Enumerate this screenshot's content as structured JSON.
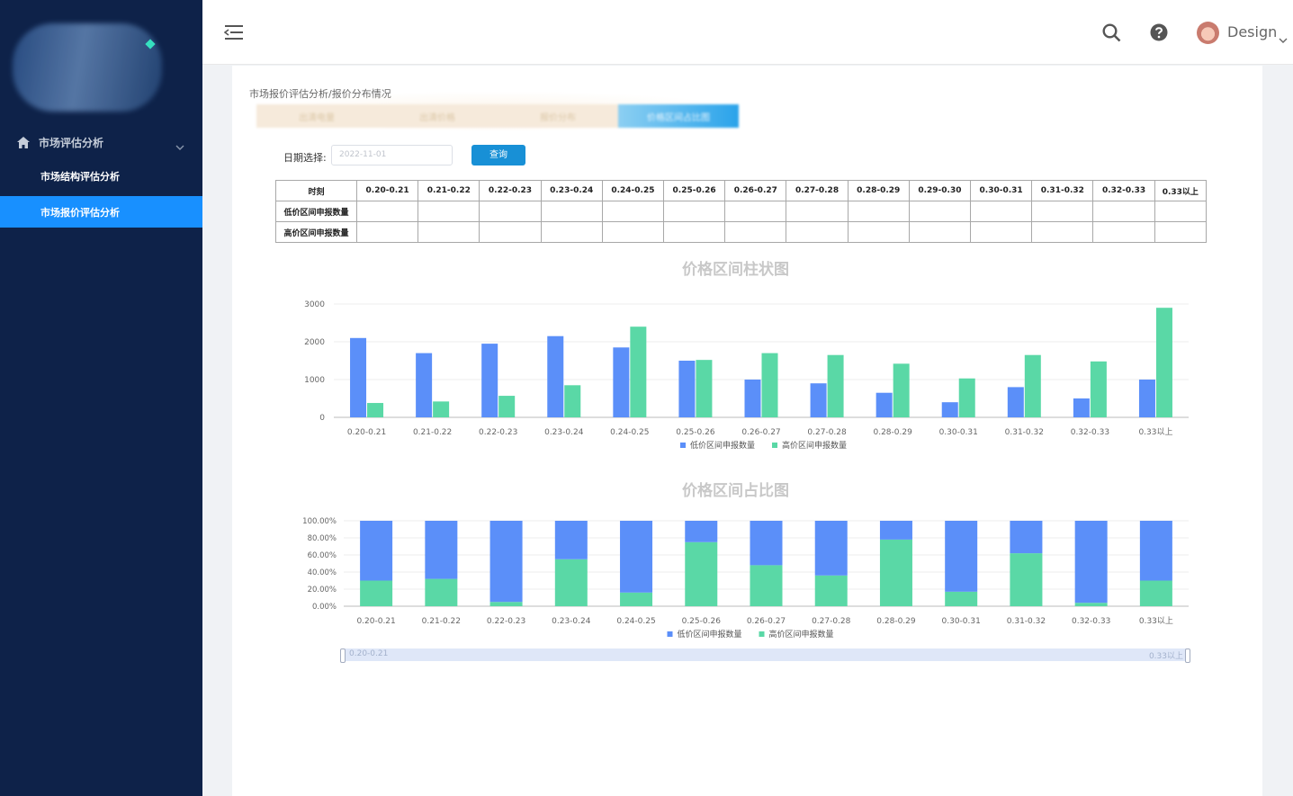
{
  "sidebar": {
    "group_label": "市场评估分析",
    "items": [
      {
        "label": "市场结构评估分析"
      },
      {
        "label": "市场报价评估分析"
      }
    ]
  },
  "header": {
    "user_name": "Design"
  },
  "breadcrumb": "市场报价评估分析/报价分布情况",
  "tabs": [
    {
      "label": "出清电量"
    },
    {
      "label": "出清价格"
    },
    {
      "label": "报价分布"
    },
    {
      "label": "价格区间占比图"
    }
  ],
  "query": {
    "date_label": "日期选择:",
    "date_value": "2022-11-01",
    "button_label": "查询"
  },
  "table": {
    "header_label": "时刻",
    "row_labels": [
      "低价区间申报数量",
      "高价区间申报数量"
    ],
    "columns": [
      "0.20-0.21",
      "0.21-0.22",
      "0.22-0.23",
      "0.23-0.24",
      "0.24-0.25",
      "0.25-0.26",
      "0.26-0.27",
      "0.27-0.28",
      "0.28-0.29",
      "0.29-0.30",
      "0.30-0.31",
      "0.31-0.32",
      "0.32-0.33",
      "0.33以上"
    ]
  },
  "colors": {
    "low": "#5b8ff9",
    "high": "#5ad8a6"
  },
  "chart_data": [
    {
      "type": "bar",
      "title": "价格区间柱状图",
      "categories": [
        "0.20-0.21",
        "0.21-0.22",
        "0.22-0.23",
        "0.23-0.24",
        "0.24-0.25",
        "0.25-0.26",
        "0.26-0.27",
        "0.27-0.28",
        "0.28-0.29",
        "0.30-0.31",
        "0.31-0.32",
        "0.32-0.33",
        "0.33以上"
      ],
      "series": [
        {
          "name": "低价区间申报数量",
          "values": [
            2100,
            1700,
            1950,
            2150,
            1850,
            1500,
            1000,
            900,
            650,
            400,
            800,
            500,
            1000
          ]
        },
        {
          "name": "高价区间申报数量",
          "values": [
            380,
            420,
            570,
            850,
            2400,
            1520,
            1700,
            1650,
            1420,
            1030,
            1650,
            1480,
            2900
          ]
        }
      ],
      "yticks": [
        "3000",
        "2000",
        "1000",
        "0"
      ],
      "ylim": [
        0,
        3000
      ],
      "legend": "bottom"
    },
    {
      "type": "bar",
      "title": "价格区间占比图",
      "stacked": true,
      "categories": [
        "0.20-0.21",
        "0.21-0.22",
        "0.22-0.23",
        "0.23-0.24",
        "0.24-0.25",
        "0.25-0.26",
        "0.26-0.27",
        "0.27-0.28",
        "0.28-0.29",
        "0.30-0.31",
        "0.31-0.32",
        "0.32-0.33",
        "0.33以上"
      ],
      "series": [
        {
          "name": "低价区间申报数量",
          "values": [
            70,
            68,
            95,
            45,
            84,
            25,
            52,
            64,
            22,
            83,
            38,
            96,
            70
          ]
        },
        {
          "name": "高价区间申报数量",
          "values": [
            30,
            32,
            5,
            55,
            16,
            75,
            48,
            36,
            78,
            17,
            62,
            4,
            30
          ]
        }
      ],
      "yticks": [
        "100.00%",
        "80.00%",
        "60.00%",
        "40.00%",
        "20.00%",
        "0.00%"
      ],
      "ylim": [
        0,
        100
      ],
      "legend": "bottom",
      "zoom_start": "0.20-0.21",
      "zoom_end": "0.33以上"
    }
  ]
}
